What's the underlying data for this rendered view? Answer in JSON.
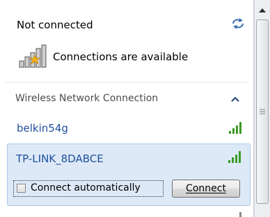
{
  "status": {
    "title": "Not connected",
    "subtitle": "Connections are available",
    "icons": {
      "refresh": "refresh-network-icon",
      "network": "network-bars-star-icon"
    }
  },
  "section": {
    "header": "Wireless Network Connection",
    "collapse_icon": "chevron-up-icon"
  },
  "networks": [
    {
      "name": "belkin54g",
      "signal_icon": "signal-strength-icon"
    },
    {
      "name": "TP-LINK_8DABCE",
      "signal_icon": "signal-strength-icon",
      "selected": true,
      "connect_automatically_label": "Connect automatically",
      "connect_automatically_checked": false,
      "connect_button_label": "Connect"
    }
  ],
  "scrollbar": {
    "up_icon": "scroll-up-arrow-icon"
  },
  "colors": {
    "link": "#1f4f9c",
    "selected_bg": "#dde9f7",
    "signal": "#3a9a24"
  }
}
